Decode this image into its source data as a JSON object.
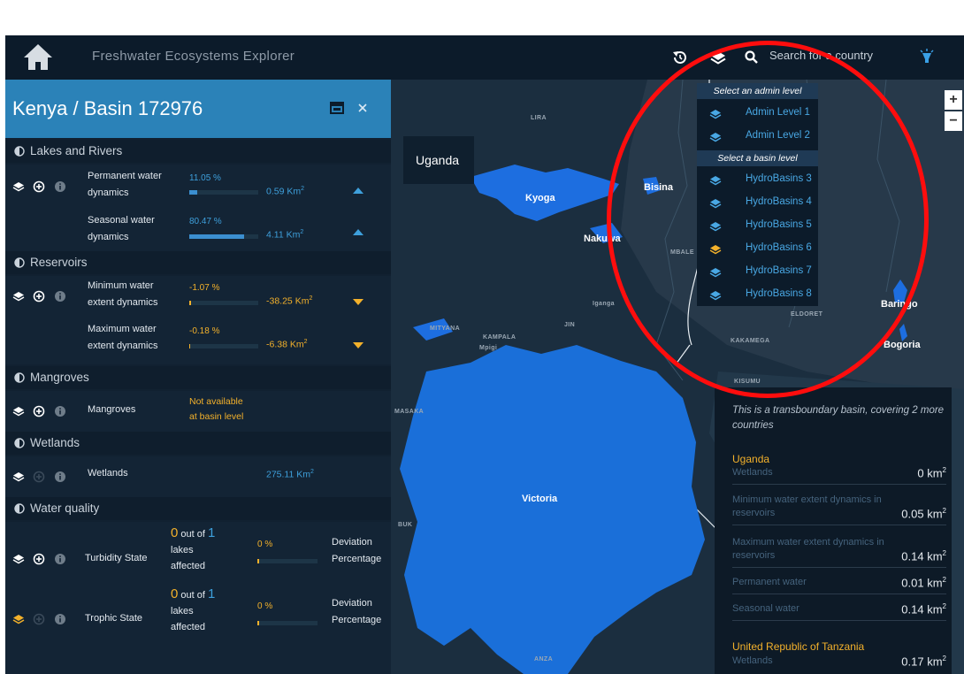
{
  "app": {
    "title": "Freshwater Ecosystems Explorer"
  },
  "search": {
    "placeholder": "Search for a country"
  },
  "icons": {
    "home": "home-icon",
    "history": "history-icon",
    "layers": "layers-icon",
    "search": "search-icon",
    "lightbulb": "lightbulb-icon",
    "maximize": "maximize-icon",
    "close": "close-icon"
  },
  "colors": {
    "accent_blue": "#2b82b8",
    "orange": "#f3b12b",
    "link_blue": "#49a8e4",
    "annotation_red": "#ff0d0d"
  },
  "sidebar": {
    "title": "Kenya / Basin 172976",
    "sections": {
      "lakes": "Lakes and Rivers",
      "reservoirs": "Reservoirs",
      "mangroves": "Mangroves",
      "wetlands": "Wetlands",
      "water_quality": "Water quality"
    },
    "indicators": {
      "permanent": {
        "name": "Permanent water dynamics",
        "pct": "11.05 %",
        "km": "0.59 Km",
        "sup": "2",
        "fill": 0.11
      },
      "seasonal": {
        "name": "Seasonal water dynamics",
        "pct": "80.47 %",
        "km": "4.11 Km",
        "sup": "2",
        "fill": 0.8
      },
      "minimum": {
        "name": "Minimum water extent dynamics",
        "pct": "-1.07 %",
        "km": "-38.25 Km",
        "sup": "2",
        "fill": 0.02
      },
      "maximum": {
        "name": "Maximum water extent dynamics",
        "pct": "-0.18 %",
        "km": "-6.38 Km",
        "sup": "2",
        "fill": 0.01
      },
      "mangroves": {
        "name": "Mangroves",
        "note_line1": "Not available",
        "note_line2": "at basin level"
      },
      "wetlands": {
        "name": "Wetlands",
        "km": "275.11 Km",
        "sup": "2"
      },
      "turbidity": {
        "name": "Turbidity State",
        "count": "0",
        "out_of": "out of",
        "total": "1",
        "lakes": "lakes",
        "affected": "affected",
        "pct": "0 %",
        "dev1": "Deviation",
        "dev2": "Percentage",
        "fill": 0.0
      },
      "trophic": {
        "name": "Trophic State",
        "count": "0",
        "out_of": "out of",
        "total": "1",
        "lakes": "lakes",
        "affected": "affected",
        "pct": "0 %",
        "dev1": "Deviation",
        "dev2": "Percentage",
        "fill": 0.0
      }
    }
  },
  "map": {
    "tooltip_country": "Uganda",
    "labels": {
      "kyoga": "Kyoga",
      "bisina": "Bisina",
      "nakuwa": "Nakuwa",
      "victoria": "Victoria",
      "baringo": "Baringo",
      "bogoria": "Bogoria"
    },
    "small_labels": {
      "lira": "LIRA",
      "mbale": "MBALE",
      "eldoret": "ELDORET",
      "kakamega": "KAKAMEGA",
      "kampala": "KAMPALA",
      "mityana": "MITYANA",
      "kisumu": "KISUMU",
      "masaka": "MASAKA",
      "bukoba": "BUK",
      "mwanza": "ANZA",
      "jinja": "JIN",
      "iganga": "Iganga",
      "mpigi": "Mpigi"
    }
  },
  "dropdown": {
    "admin_header": "Select an admin level",
    "admin_items": [
      "Admin Level 1",
      "Admin Level 2"
    ],
    "basin_header": "Select a basin level",
    "basin_items": [
      "HydroBasins 3",
      "HydroBasins 4",
      "HydroBasins 5",
      "HydroBasins 6",
      "HydroBasins 7",
      "HydroBasins 8"
    ],
    "selected_basin": "HydroBasins 6"
  },
  "zoom": {
    "in": "+",
    "out": "−"
  },
  "info": {
    "intro": "This is a transboundary basin, covering 2 more countries",
    "countries": [
      {
        "name": "Uganda",
        "rows": [
          {
            "label": "Wetlands",
            "value": "0 km",
            "sup": "2"
          },
          {
            "label": "Minimum water extent dynamics in reservoirs",
            "value": "0.05 km",
            "sup": "2"
          },
          {
            "label": "Maximum water extent dynamics in reservoirs",
            "value": "0.14 km",
            "sup": "2"
          },
          {
            "label": "Permanent water",
            "value": "0.01 km",
            "sup": "2"
          },
          {
            "label": "Seasonal water",
            "value": "0.14 km",
            "sup": "2"
          }
        ]
      },
      {
        "name": "United Republic of Tanzania",
        "rows": [
          {
            "label": "Wetlands",
            "value": "0.17 km",
            "sup": "2"
          }
        ]
      }
    ]
  }
}
